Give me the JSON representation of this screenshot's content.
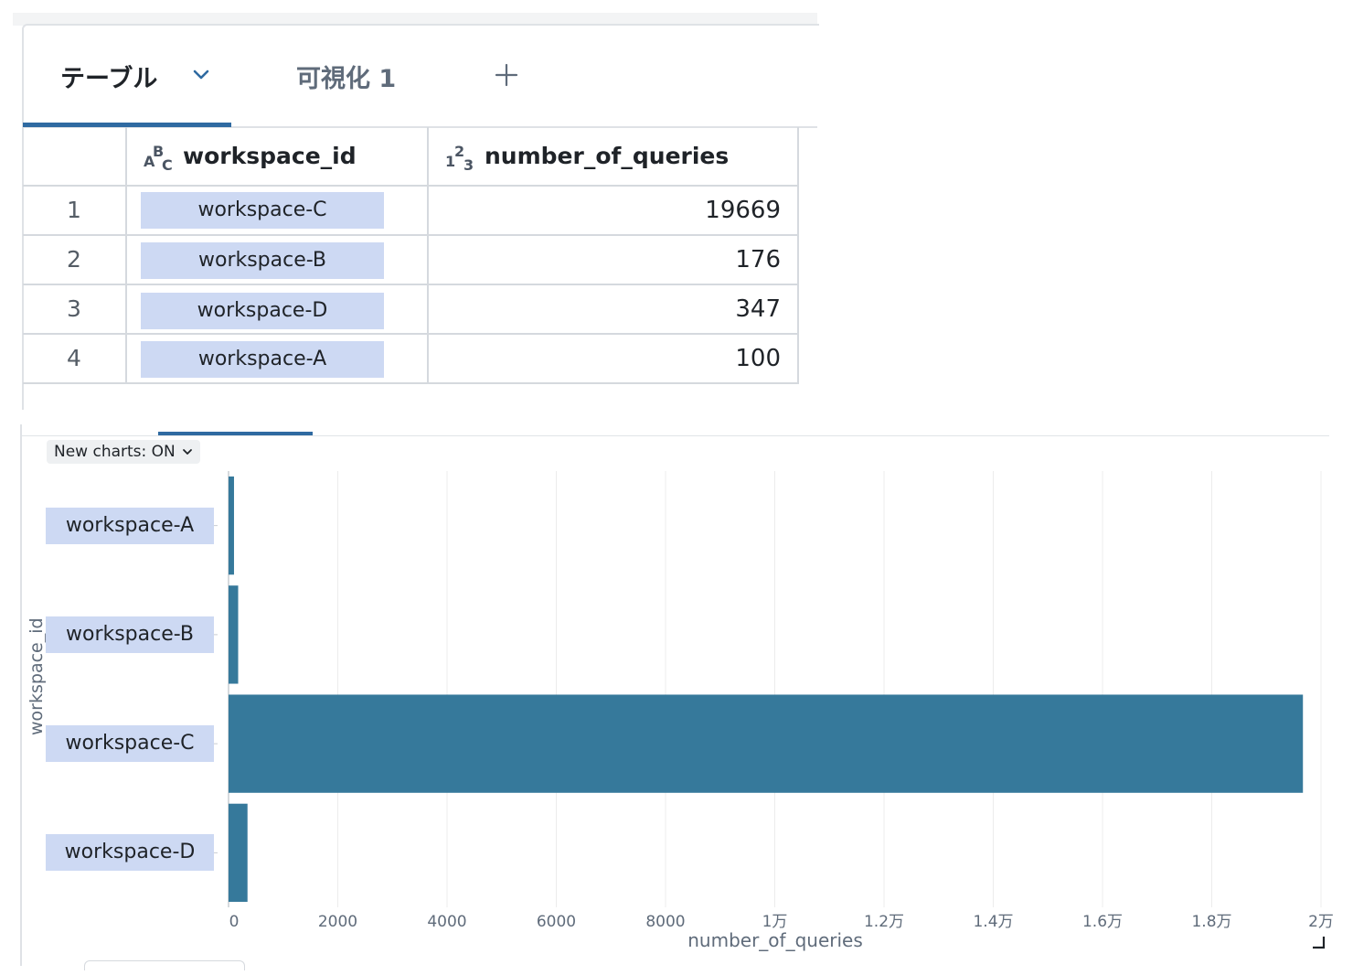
{
  "tabs": {
    "table_label": "テーブル",
    "viz_label": "可視化 1",
    "add_label": "+"
  },
  "table": {
    "columns": [
      {
        "icon": "string-type-icon",
        "name": "workspace_id"
      },
      {
        "icon": "number-type-icon",
        "name": "number_of_queries"
      }
    ],
    "rows": [
      {
        "index": "1",
        "workspace_id": "workspace-C",
        "number_of_queries": "19669"
      },
      {
        "index": "2",
        "workspace_id": "workspace-B",
        "number_of_queries": "176"
      },
      {
        "index": "3",
        "workspace_id": "workspace-D",
        "number_of_queries": "347"
      },
      {
        "index": "4",
        "workspace_id": "workspace-A",
        "number_of_queries": "100"
      }
    ]
  },
  "chart_toolbar": {
    "new_charts_label": "New charts: ON"
  },
  "chart_data": {
    "type": "bar",
    "orientation": "horizontal",
    "categories": [
      "workspace-A",
      "workspace-B",
      "workspace-C",
      "workspace-D"
    ],
    "values": [
      100,
      176,
      19669,
      347
    ],
    "xlabel": "number_of_queries",
    "ylabel": "workspace_id",
    "xlim": [
      0,
      20000
    ],
    "xticks": [
      0,
      2000,
      4000,
      6000,
      8000,
      10000,
      12000,
      14000,
      16000,
      18000,
      20000
    ],
    "xtick_labels": [
      "0",
      "2000",
      "4000",
      "6000",
      "8000",
      "1万",
      "1.2万",
      "1.4万",
      "1.6万",
      "1.8万",
      "2万"
    ],
    "grid": true,
    "bar_color": "#36799b"
  }
}
